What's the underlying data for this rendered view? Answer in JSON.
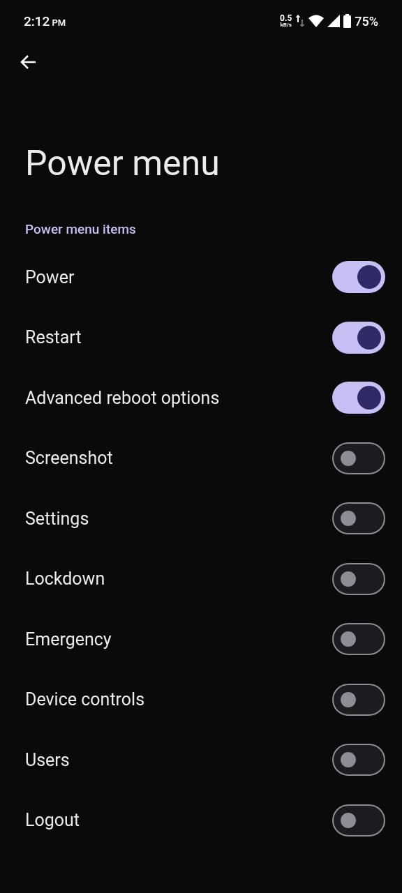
{
  "status_bar": {
    "time": "2:12",
    "time_suffix": "PM",
    "net_speed": "0.5",
    "net_unit": "kB/s",
    "battery": "75%"
  },
  "title": "Power menu",
  "section": "Power menu items",
  "items": [
    {
      "label": "Power",
      "on": true
    },
    {
      "label": "Restart",
      "on": true
    },
    {
      "label": "Advanced reboot options",
      "on": true
    },
    {
      "label": "Screenshot",
      "on": false
    },
    {
      "label": "Settings",
      "on": false
    },
    {
      "label": "Lockdown",
      "on": false
    },
    {
      "label": "Emergency",
      "on": false
    },
    {
      "label": "Device controls",
      "on": false
    },
    {
      "label": "Users",
      "on": false
    },
    {
      "label": "Logout",
      "on": false
    }
  ]
}
